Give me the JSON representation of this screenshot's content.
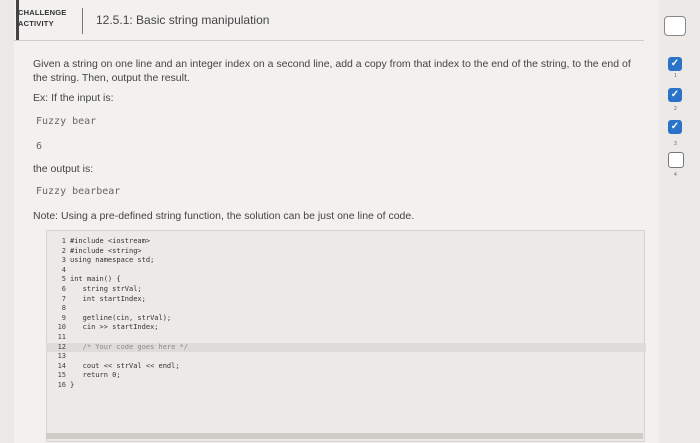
{
  "header": {
    "badge_line1": "CHALLENGE",
    "badge_line2": "ACTIVITY",
    "title": "12.5.1: Basic string manipulation"
  },
  "prompt": {
    "description_line1": "Given a string on one line and an integer index on a second line, add a copy from that index to the end of the string, to the end of",
    "description_line2": "the string. Then, output the result.",
    "ex_label": "Ex: If the input is:",
    "input_string": "Fuzzy bear",
    "input_index": "6",
    "output_label": "the output is:",
    "output_string": "Fuzzy bearbear",
    "note": "Note: Using a pre-defined string function, the solution can be just one line of code."
  },
  "code": {
    "lines": [
      {
        "n": "1",
        "text": "#include <iostream>"
      },
      {
        "n": "2",
        "text": "#include <string>"
      },
      {
        "n": "3",
        "text": "using namespace std;"
      },
      {
        "n": "4",
        "text": ""
      },
      {
        "n": "5",
        "text": "int main() {"
      },
      {
        "n": "6",
        "text": "   string strVal;"
      },
      {
        "n": "7",
        "text": "   int startIndex;"
      },
      {
        "n": "8",
        "text": ""
      },
      {
        "n": "9",
        "text": "   getline(cin, strVal);"
      },
      {
        "n": "10",
        "text": "   cin >> startIndex;"
      },
      {
        "n": "11",
        "text": ""
      },
      {
        "n": "12",
        "text": "   /* Your code goes here */"
      },
      {
        "n": "13",
        "text": ""
      },
      {
        "n": "14",
        "text": "   cout << strVal << endl;"
      },
      {
        "n": "15",
        "text": "   return 0;"
      },
      {
        "n": "16",
        "text": "}"
      }
    ]
  },
  "steps": {
    "numbers": [
      "1",
      "2",
      "3",
      "4"
    ],
    "check_glyph": "✓"
  }
}
